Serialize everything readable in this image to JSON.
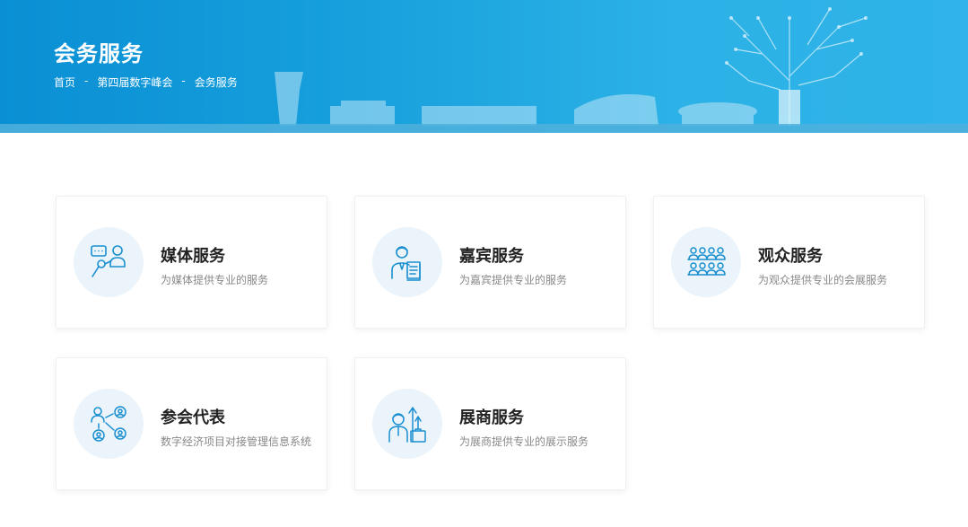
{
  "header": {
    "title": "会务服务",
    "breadcrumb": [
      "首页",
      "第四届数字峰会",
      "会务服务"
    ],
    "separator": "-"
  },
  "cards": [
    {
      "title": "媒体服务",
      "desc": "为媒体提供专业的服务",
      "icon": "media-interview-icon"
    },
    {
      "title": "嘉宾服务",
      "desc": "为嘉宾提供专业的服务",
      "icon": "guest-document-icon"
    },
    {
      "title": "观众服务",
      "desc": "为观众提供专业的会展服务",
      "icon": "audience-group-icon"
    },
    {
      "title": "参会代表",
      "desc": "数字经济项目对接管理信息系统",
      "icon": "delegate-network-icon"
    },
    {
      "title": "展商服务",
      "desc": "为展商提供专业的展示服务",
      "icon": "exhibitor-growth-icon"
    }
  ],
  "colors": {
    "accent": "#0a8fd4",
    "icon": "#1a8fd0",
    "icon_bg": "#eaf4fa"
  }
}
